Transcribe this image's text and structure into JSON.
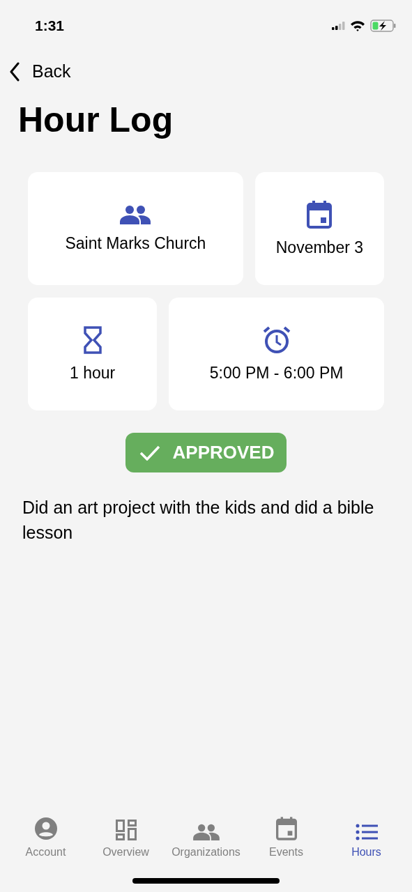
{
  "status_bar": {
    "time": "1:31"
  },
  "nav": {
    "back": "Back"
  },
  "title": "Hour Log",
  "details": [
    {
      "kind": "organization",
      "text": "Saint Marks Church"
    },
    {
      "kind": "date",
      "text": "November 3"
    },
    {
      "kind": "duration",
      "text": "1 hour"
    },
    {
      "kind": "time",
      "text": "5:00 PM - 6:00 PM"
    }
  ],
  "status": {
    "label": "APPROVED",
    "approved": true
  },
  "description": "Did an art project with the kids and did a bible lesson",
  "tabs": [
    {
      "kind": "account",
      "label": "Account",
      "selected": false
    },
    {
      "kind": "overview",
      "label": "Overview",
      "selected": false
    },
    {
      "kind": "organizations",
      "label": "Organizations",
      "selected": false
    },
    {
      "kind": "events",
      "label": "Events",
      "selected": false
    },
    {
      "kind": "hours",
      "label": "Hours",
      "selected": true
    }
  ]
}
